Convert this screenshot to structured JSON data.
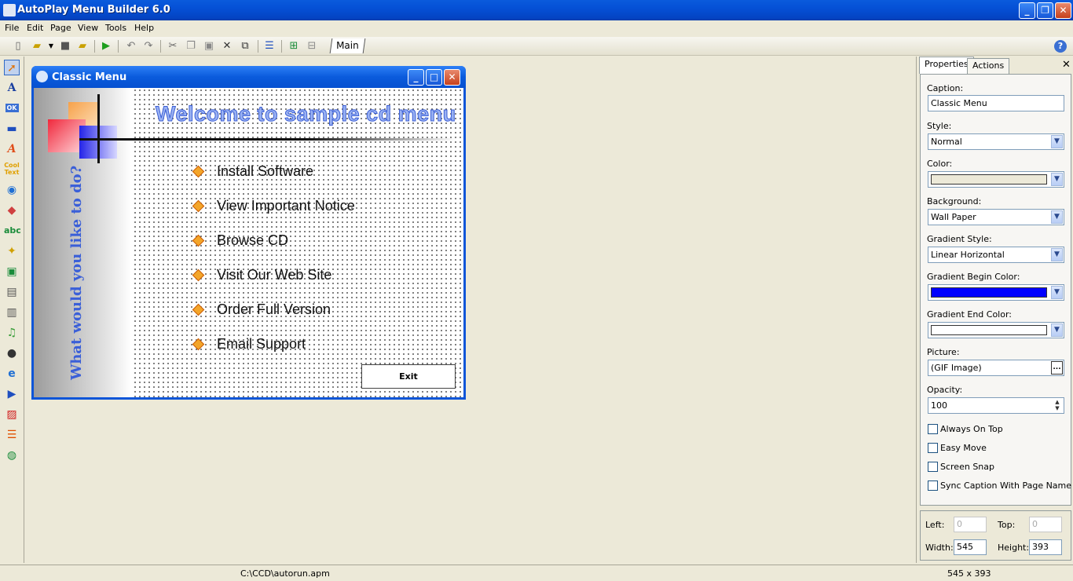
{
  "window": {
    "title": "AutoPlay Menu Builder 6.0",
    "minimize": "_",
    "maximize": "❐",
    "close": "✕"
  },
  "menubar": [
    "File",
    "Edit",
    "Page",
    "View",
    "Tools",
    "Help"
  ],
  "toolbar": {
    "page_tab": "Main",
    "help": "?"
  },
  "designer": {
    "title": "Classic Menu",
    "welcome": "Welcome to sample cd menu",
    "vertical_text": "What would you like to do?",
    "items": [
      "Install Software",
      "View Important Notice",
      "Browse CD",
      "Visit Our Web Site",
      "Order Full Version",
      "Email Support"
    ],
    "exit_label": "Exit",
    "dw_min": "_",
    "dw_max": "□",
    "dw_close": "✕"
  },
  "panel": {
    "tabs": [
      "Properties",
      "Actions"
    ],
    "close": "✕",
    "caption_label": "Caption:",
    "caption_value": "Classic Menu",
    "style_label": "Style:",
    "style_value": "Normal",
    "color_label": "Color:",
    "color_value": "#ece9d8",
    "background_label": "Background:",
    "background_value": "Wall Paper",
    "gradient_style_label": "Gradient Style:",
    "gradient_style_value": "Linear Horizontal",
    "gradient_begin_label": "Gradient Begin Color:",
    "gradient_begin_value": "#0000ff",
    "gradient_end_label": "Gradient End Color:",
    "gradient_end_value": "#ffffff",
    "picture_label": "Picture:",
    "picture_value": "(GIF Image)",
    "picture_button": "...",
    "opacity_label": "Opacity:",
    "opacity_value": "100",
    "checkboxes": [
      "Always On Top",
      "Easy Move",
      "Screen Snap",
      "Sync Caption With Page Name"
    ],
    "left_label": "Left:",
    "left_value": "0",
    "top_label": "Top:",
    "top_value": "0",
    "width_label": "Width:",
    "width_value": "545",
    "height_label": "Height:",
    "height_value": "393"
  },
  "status": {
    "path": "C:\\CCD\\autorun.apm",
    "size": "545 x 393"
  }
}
